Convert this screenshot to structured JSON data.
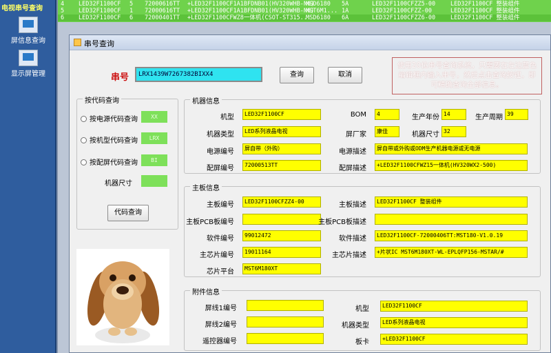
{
  "sidebar": {
    "title": "电视串号查询",
    "items": [
      {
        "label": "屏信息查询",
        "icon": "monitor-icon"
      },
      {
        "label": "显示屏管理",
        "icon": "document-icon"
      }
    ]
  },
  "background_table": {
    "rows": [
      [
        "4",
        "LED32F1100CF",
        "5",
        "72000616TT",
        "+LED32F1100CF1A1BFDNB01(HV320WHB-N6)",
        "MSD6180",
        "5A",
        "LED32F1100CFZZ5-00",
        "LED32F1100CF 整装组件"
      ],
      [
        "5",
        "LED32F1100CF",
        "1",
        "72000616TT",
        "+LED32F1100CF1A1BFDNB01(HV320WHB-N6)",
        "MST6M1...",
        "1A",
        "LED32F1100CFZZ-00",
        "LED32F1100CF 整装组件"
      ],
      [
        "6",
        "LED32F1100CF",
        "6",
        "72000401TT",
        "+LED32F1100CFWZ8一体机(CSOT-ST315...",
        "MSD6180",
        "6A",
        "LED32F1100CFZZ6-00",
        "LED32F1100CF 整装组件"
      ]
    ]
  },
  "dialog": {
    "title": "串号查询",
    "serial_label": "串号",
    "serial_value": "LRX1439W7267382BIXX4",
    "query_button": "查询",
    "cancel_button": "取消",
    "hint_text": "使用20位串号查询系统，只需要在左边蓝色编辑框内输入串号，然后点击查询按钮，即可精确查询全部信息。",
    "code_query": {
      "title": "按代码查询",
      "options": [
        {
          "label": "按电源代码查询",
          "code": "XX"
        },
        {
          "label": "按机型代码查询",
          "code": "LRX"
        },
        {
          "label": "按配屏代码查询",
          "code": "BI"
        }
      ],
      "size_label": "机器尺寸",
      "size_value": "",
      "button": "代码查询"
    },
    "machine_info": {
      "title": "机器信息",
      "model_label": "机型",
      "model": "LED32F1100CF",
      "bom_label": "BOM",
      "bom": "4",
      "year_label": "生产年份",
      "year": "14",
      "week_label": "生产周期",
      "week": "39",
      "type_label": "机器类型",
      "type": "LED系列液晶电视",
      "panel_maker_label": "屏厂家",
      "panel_maker": "康佳",
      "size_label": "机器尺寸",
      "size": "32",
      "power_code_label": "电源编号",
      "power_code": "屏自带（外购）",
      "power_desc_label": "电源描述",
      "power_desc": "屏自带或外购或ODM生产机器电源或无电源",
      "screen_code_label": "配屏编号",
      "screen_code": "72000513TT",
      "screen_desc_label": "配屏描述",
      "screen_desc": "+LED32F1100CFWZ15一体机(HV320WX2-500)"
    },
    "mainboard_info": {
      "title": "主板信息",
      "board_code_label": "主板编号",
      "board_code": "LED32F1100CFZZ4-00",
      "board_desc_label": "主板描述",
      "board_desc": "LED32F1100CF 整装组件",
      "pcb_code_label": "主板PCB板编号",
      "pcb_code": "",
      "pcb_desc_label": "主板PCB板描述",
      "pcb_desc": "",
      "sw_code_label": "软件编号",
      "sw_code": "99012472",
      "sw_desc_label": "软件描述",
      "sw_desc": "LED32F1100CF-72000406TT:MST180-V1.0.19",
      "chip_code_label": "主芯片编号",
      "chip_code": "19011164",
      "chip_desc_label": "主芯片描述",
      "chip_desc": "+片状IC MST6M180XT-WL-EPLQFP156-MSTAR/#",
      "platform_label": "芯片平台",
      "platform": "MST6M180XT"
    },
    "accessory_info": {
      "title": "附件信息",
      "line1_label": "屏线1编号",
      "line1": "",
      "line2_label": "屏线2编号",
      "line2": "",
      "remote_label": "遥控器编号",
      "remote": "",
      "r1_label": "机型",
      "r1": "LED32F1100CF",
      "r2_label": "机器类型",
      "r2": "LED系列液晶电视",
      "r3_label": "板卡",
      "r3": "+LED32F1100CF"
    }
  }
}
